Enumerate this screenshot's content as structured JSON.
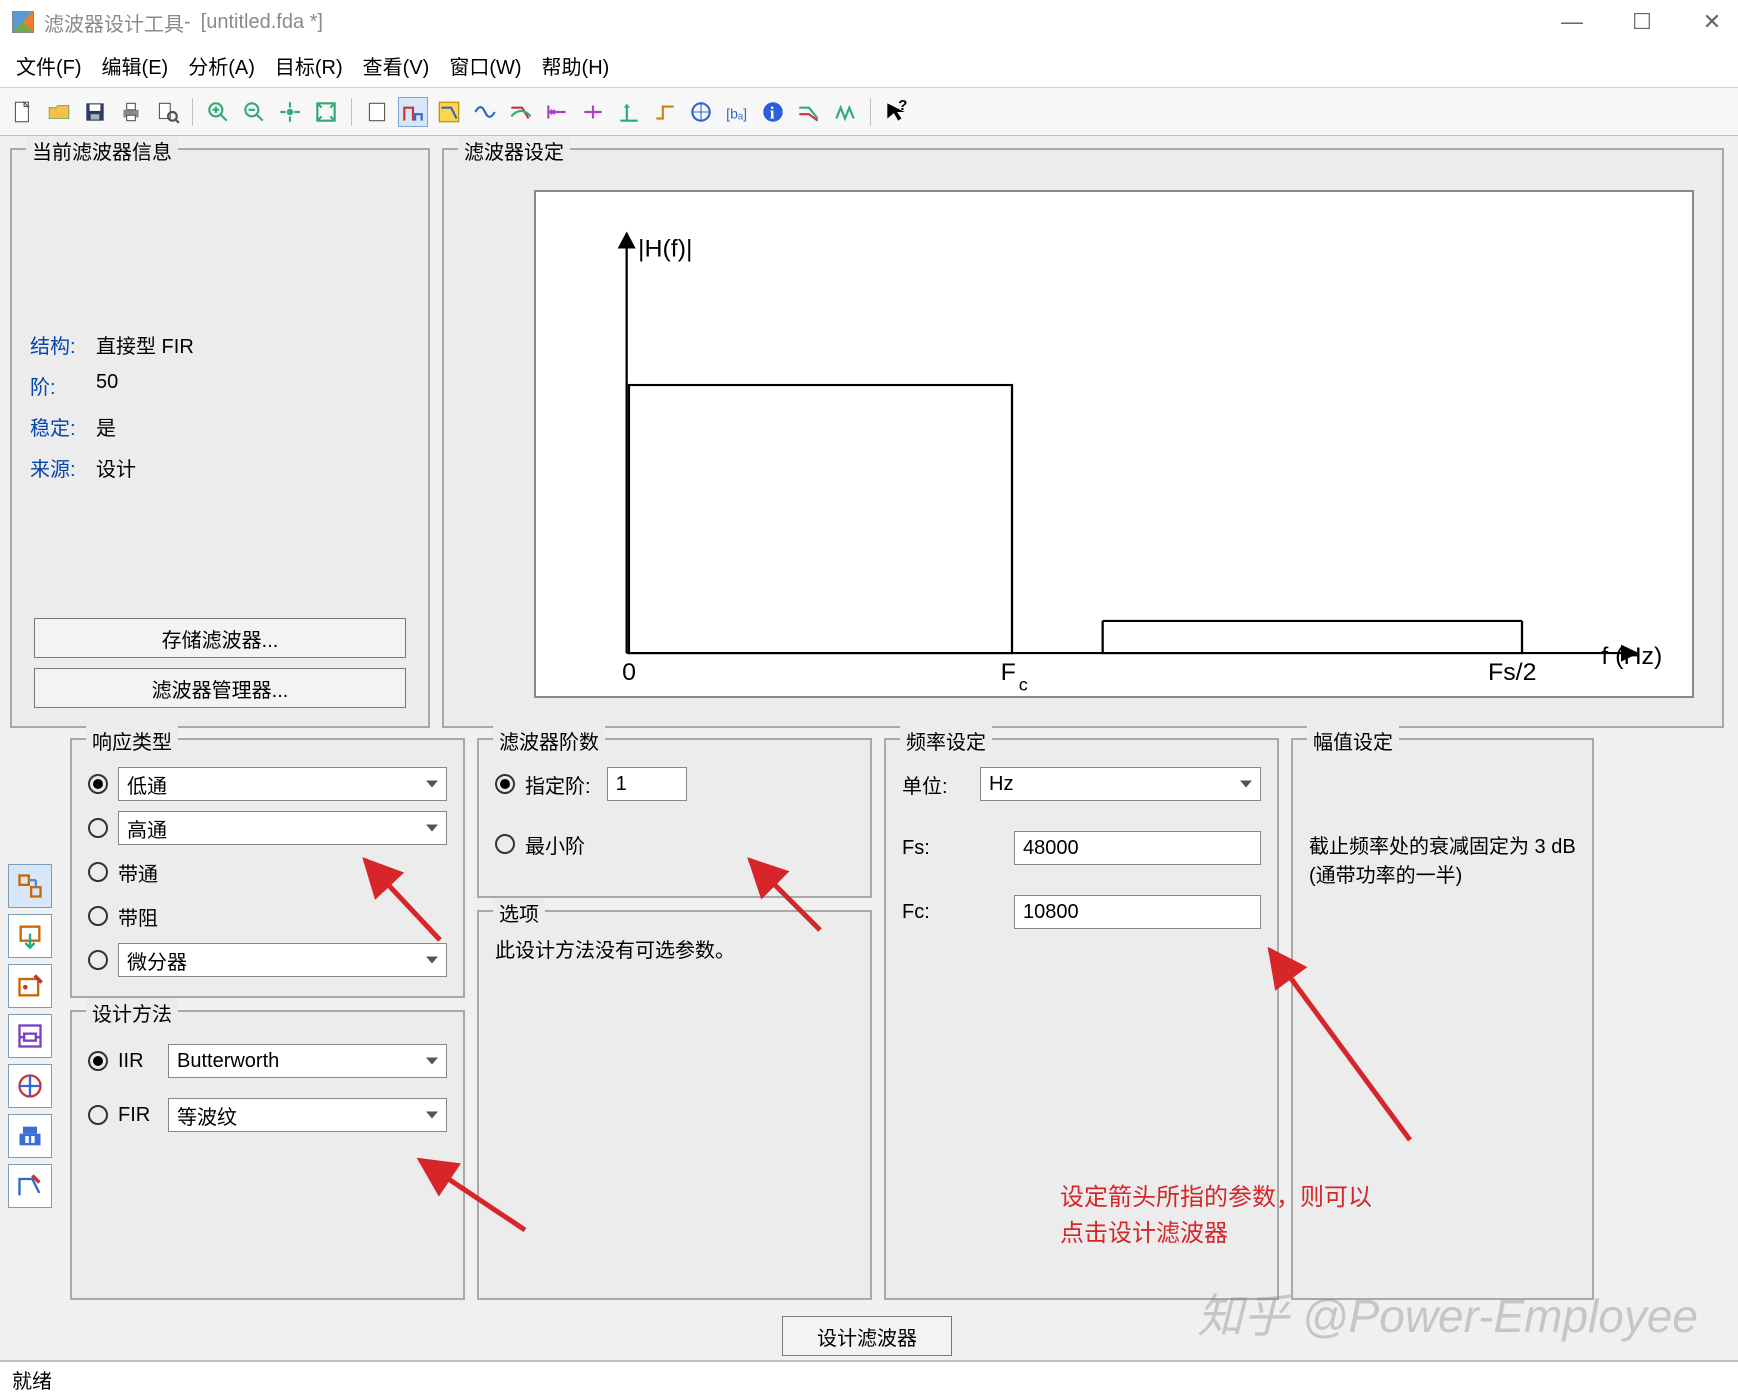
{
  "titlebar": {
    "app": "滤波器设计工具",
    "sep": " - ",
    "doc": "[untitled.fda *]"
  },
  "menus": [
    "文件(F)",
    "编辑(E)",
    "分析(A)",
    "目标(R)",
    "查看(V)",
    "窗口(W)",
    "帮助(H)"
  ],
  "toolbar_icons": [
    "new",
    "open",
    "save",
    "print",
    "print-preview",
    "zoom-in",
    "zoom-out",
    "pan",
    "fit",
    "page",
    "spec-active",
    "mag",
    "phase",
    "group-delay",
    "impulse",
    "step",
    "pole-zero",
    "coeff",
    "round",
    "filter-info",
    "info",
    "view-a",
    "view-b",
    "whats-this"
  ],
  "info": {
    "legend": "当前滤波器信息",
    "rows": [
      {
        "label": "结构:",
        "value": "直接型 FIR"
      },
      {
        "label": "阶:",
        "value": "50"
      },
      {
        "label": "稳定:",
        "value": "是"
      },
      {
        "label": "来源:",
        "value": "设计"
      }
    ],
    "buttons": [
      "存储滤波器...",
      "滤波器管理器..."
    ]
  },
  "spec": {
    "legend": "滤波器设定",
    "ylabel": "|H(f)|",
    "x0": "0",
    "xc": "F",
    "xcs": "c",
    "xnyq": "Fs/2",
    "xlabel": "f (Hz)"
  },
  "sidebar_icons": [
    "design-filter",
    "import-filter",
    "pole-zero-editor",
    "realize-model",
    "multirate",
    "cic",
    "quantize"
  ],
  "response": {
    "legend": "响应类型",
    "items": [
      {
        "type": "dd",
        "label": "低通",
        "checked": true
      },
      {
        "type": "dd",
        "label": "高通",
        "checked": false
      },
      {
        "type": "plain",
        "label": "带通",
        "checked": false
      },
      {
        "type": "plain",
        "label": "带阻",
        "checked": false
      },
      {
        "type": "dd",
        "label": "微分器",
        "checked": false
      }
    ]
  },
  "method": {
    "legend": "设计方法",
    "iir": {
      "label": "IIR",
      "dd": "Butterworth",
      "checked": true
    },
    "fir": {
      "label": "FIR",
      "dd": "等波纹",
      "checked": false
    }
  },
  "order": {
    "legend": "滤波器阶数",
    "specify": {
      "label": "指定阶:",
      "value": "1",
      "checked": true
    },
    "min": {
      "label": "最小阶",
      "checked": false
    }
  },
  "options": {
    "legend": "选项",
    "text": "此设计方法没有可选参数。"
  },
  "freq": {
    "legend": "频率设定",
    "unit_label": "单位:",
    "unit": "Hz",
    "fs_label": "Fs:",
    "fs": "48000",
    "fc_label": "Fc:",
    "fc": "10800"
  },
  "mag": {
    "legend": "幅值设定",
    "text1": "截止频率处的衰减固定为 3 dB",
    "text2": "(通带功率的一半)"
  },
  "design_button": "设计滤波器",
  "statusbar": "就绪",
  "annotation": {
    "line1": "设定箭头所指的参数，则可以",
    "line2": "点击设计滤波器"
  },
  "watermark": "知乎 @Power-Employee"
}
